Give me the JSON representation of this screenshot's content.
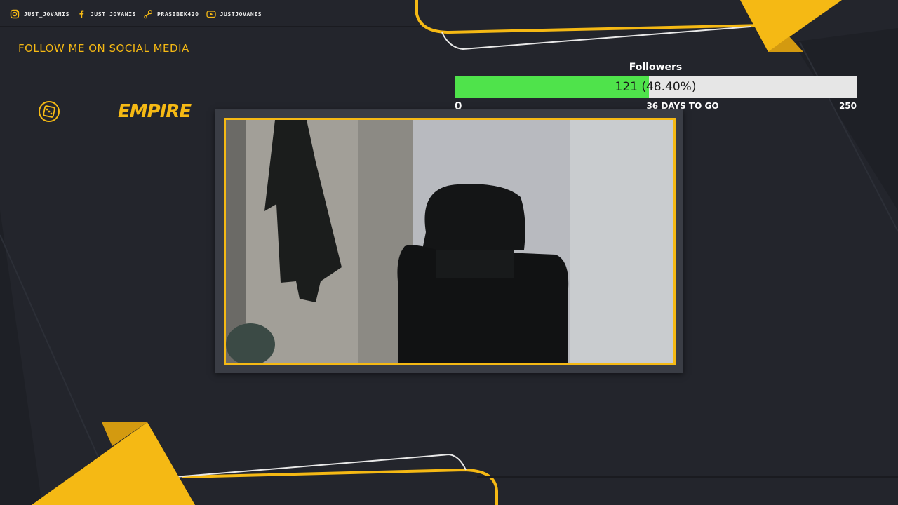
{
  "social": [
    {
      "icon": "instagram-icon",
      "handle": "JUST_JOVANIS"
    },
    {
      "icon": "facebook-icon",
      "handle": "JUST JOVANIS"
    },
    {
      "icon": "steam-icon",
      "handle": "PRASIBEK420"
    },
    {
      "icon": "youtube-icon",
      "handle": "JUSTJOVANIS"
    }
  ],
  "follow_title": "FOLLOW ME ON SOCIAL MEDIA",
  "logo": {
    "icon": "dice-icon",
    "text": "EMPIRE"
  },
  "goal": {
    "title": "Followers",
    "current": 121,
    "percent_text": "121 (48.40%)",
    "progress": 0.484,
    "min": "0",
    "max": "250",
    "days_left": "36 DAYS TO GO"
  },
  "webcam": {
    "icon": "webcam-feed"
  },
  "colors": {
    "background": "#23252c",
    "accent": "#f5b914",
    "progress_fill": "#4fe34b",
    "progress_track": "#e6e6e6",
    "frame": "#3a3d45"
  }
}
